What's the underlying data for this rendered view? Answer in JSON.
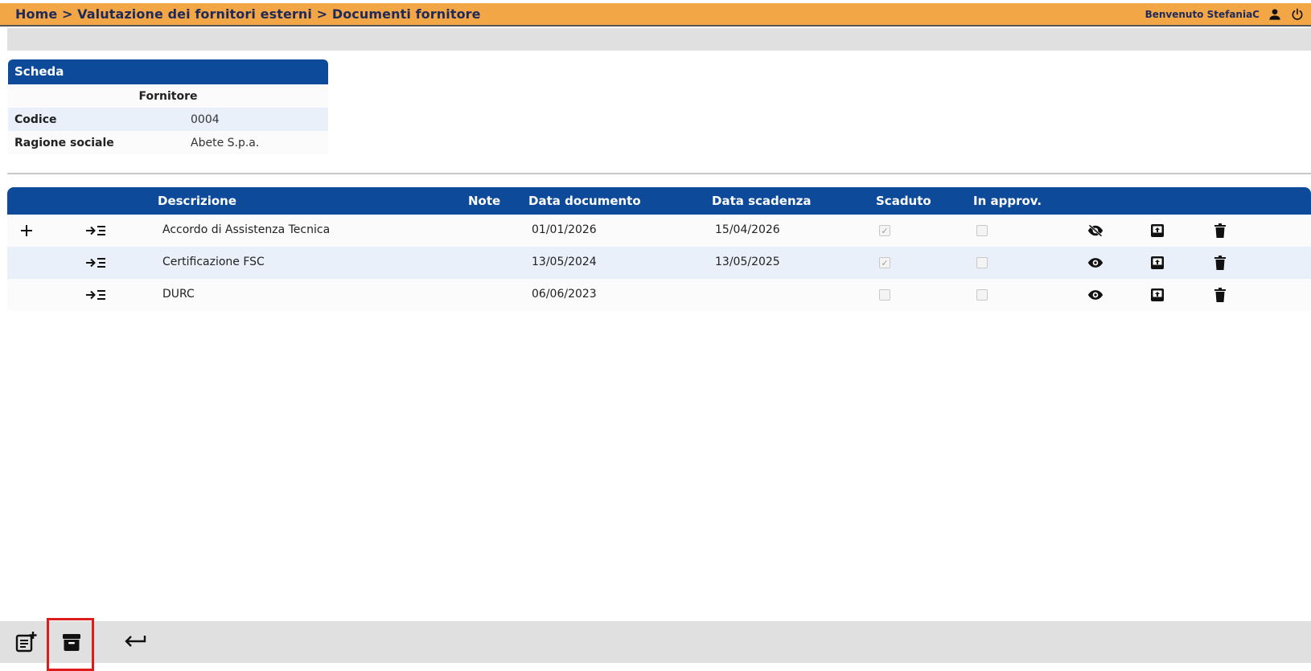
{
  "header": {
    "breadcrumb": "Home > Valutazione dei fornitori esterni > Documenti fornitore",
    "welcome": "Benvenuto StefaniaC",
    "icons": [
      "user-icon",
      "power-icon"
    ]
  },
  "scheda": {
    "title": "Scheda",
    "subtitle": "Fornitore",
    "rows": [
      {
        "label": "Codice",
        "value": "0004"
      },
      {
        "label": "Ragione sociale",
        "value": "Abete S.p.a."
      }
    ]
  },
  "documents": {
    "columns": [
      "Descrizione",
      "Note",
      "Data documento",
      "Data scadenza",
      "Scaduto",
      "In approv."
    ],
    "rows": [
      {
        "descrizione": "Accordo di Assistenza Tecnica",
        "note": "",
        "data_documento": "01/01/2026",
        "data_scadenza": "15/04/2026",
        "scaduto": true,
        "in_approv": false,
        "view_icon": "eye-off-icon",
        "has_add": true
      },
      {
        "descrizione": "Certificazione FSC",
        "note": "",
        "data_documento": "13/05/2024",
        "data_scadenza": "13/05/2025",
        "scaduto": true,
        "in_approv": false,
        "view_icon": "eye-icon",
        "has_add": false
      },
      {
        "descrizione": "DURC",
        "note": "",
        "data_documento": "06/06/2023",
        "data_scadenza": "",
        "scaduto": false,
        "in_approv": false,
        "view_icon": "eye-icon",
        "has_add": false
      }
    ]
  },
  "bottom_toolbar": {
    "buttons": [
      "new-document-icon",
      "archive-icon",
      "back-arrow-icon"
    ],
    "highlighted": "archive-icon"
  },
  "colors": {
    "header_bg": "#f2a646",
    "primary_blue": "#0d4a9a",
    "row_alt": "#e9f0fa",
    "highlight": "#e01b1b"
  }
}
